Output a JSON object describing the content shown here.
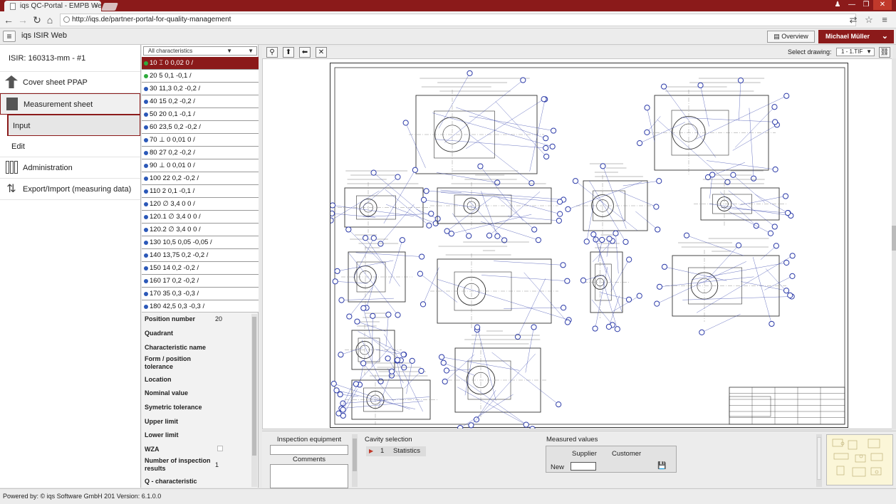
{
  "browser": {
    "tab_title": "iqs QC-Portal - EMPB Web",
    "url": "http://iqs.de/partner-portal-for-quality-management"
  },
  "header": {
    "menu_icon": "hamburger-icon",
    "app_title": "iqs  ISIR Web",
    "overview_label": "Overview",
    "user_name": "Michael Müller"
  },
  "sidebar": {
    "isir_label": "ISIR: 160313-mm - #1",
    "items": [
      {
        "label": "Cover sheet PPAP",
        "icon": "upload-arrow-icon"
      },
      {
        "label": "Measurement sheet",
        "icon": "clipboard-icon"
      },
      {
        "label": "Input",
        "icon": ""
      },
      {
        "label": "Edit",
        "icon": ""
      },
      {
        "label": "Administration",
        "icon": "columns-icon"
      },
      {
        "label": "Export/Import (measuring data)",
        "icon": "import-export-icon"
      }
    ]
  },
  "characteristics": {
    "filter_value": "All characteristics",
    "items": [
      {
        "label": "10   ⌶    0 0,02 0 /",
        "dot": "green"
      },
      {
        "label": "20 5 0,1 -0,1 /",
        "dot": "green"
      },
      {
        "label": "30 11,3 0,2 -0,2 /",
        "dot": "blue"
      },
      {
        "label": "40 15 0,2 -0,2 /",
        "dot": "blue"
      },
      {
        "label": "50 20 0,1 -0,1 /",
        "dot": "blue"
      },
      {
        "label": "60 23,5 0,2 -0,2 /",
        "dot": "blue"
      },
      {
        "label": "70  ⊥    0 0,01 0 /",
        "dot": "blue"
      },
      {
        "label": "80 27 0,2 -0,2 /",
        "dot": "blue"
      },
      {
        "label": "90  ⊥    0 0,01 0 /",
        "dot": "blue"
      },
      {
        "label": "100 22 0,2 -0,2 /",
        "dot": "blue"
      },
      {
        "label": "110 2 0,1 -0,1 /",
        "dot": "blue"
      },
      {
        "label": "120  ∅    3,4 0 0 /",
        "dot": "blue"
      },
      {
        "label": "120.1  ∅    3,4 0 0 /",
        "dot": "blue"
      },
      {
        "label": "120.2  ∅    3,4 0 0 /",
        "dot": "blue"
      },
      {
        "label": "130 10,5 0,05 -0,05 /",
        "dot": "blue"
      },
      {
        "label": "140 13,75 0,2 -0,2 /",
        "dot": "blue"
      },
      {
        "label": "150 14 0,2 -0,2 /",
        "dot": "blue"
      },
      {
        "label": "160 17 0,2 -0,2 /",
        "dot": "blue"
      },
      {
        "label": "170 35 0,3 -0,3 /",
        "dot": "blue"
      },
      {
        "label": "180 42,5 0,3 -0,3 /",
        "dot": "blue"
      }
    ]
  },
  "details": {
    "position_number_label": "Position number",
    "position_number_value": "20",
    "quadrant_label": "Quadrant",
    "char_name_label": "Characteristic name",
    "form_label": "Form / position tolerance",
    "location_label": "Location",
    "nominal_label": "Nominal value",
    "symmetric_label": "Symetric tolerance",
    "upper_label": "Upper limit",
    "lower_label": "Lower limit",
    "wza_label": "WZA",
    "num_results_label": "Number of inspection results",
    "num_results_value": "1",
    "q_label": "Q - characteristic"
  },
  "toolbar": {
    "select_drawing_label": "Select drawing:",
    "drawing_value": "1 - 1.TIF"
  },
  "bottom": {
    "inspection_label": "Inspection equipment",
    "comments_label": "Comments",
    "cavity_title": "Cavity selection",
    "cavity_num": "1",
    "cavity_label": "Statistics",
    "measured_title": "Measured values",
    "supplier_label": "Supplier",
    "customer_label": "Customer",
    "new_label": "New"
  },
  "footer": {
    "text": "Powered by: © iqs Software GmbH 201   Version: 6.1.0.0"
  }
}
